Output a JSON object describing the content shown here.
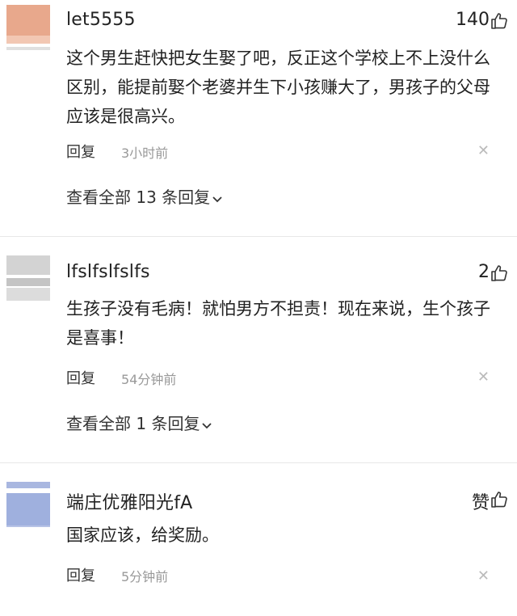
{
  "comments": [
    {
      "username": "let5555",
      "likes": "140",
      "body": "这个男生赶快把女生娶了吧，反正这个学校上不上没什么区别，能提前娶个老婆并生下小孩赚大了，男孩子的父母应该是很高兴。",
      "reply_label": "回复",
      "time": "3小时前",
      "view_all": "查看全部 13 条回复",
      "avatar_colors": [
        "#e8a88c",
        "#f2c7b3",
        "#e0e0e0"
      ]
    },
    {
      "username": "lfslfslfslfs",
      "likes": "2",
      "body": "生孩子没有毛病！就怕男方不担责！现在来说，生个孩子是喜事！",
      "reply_label": "回复",
      "time": "54分钟前",
      "view_all": "查看全部 1 条回复",
      "avatar_colors": [
        "#d3d3d3",
        "#c4c4c4",
        "#dcdcdc"
      ]
    },
    {
      "username": "端庄优雅阳光fA",
      "likes": "赞",
      "body": "国家应该，给奖励。",
      "reply_label": "回复",
      "time": "5分钟前",
      "avatar_colors": [
        "#a9b7e0",
        "#9fb0de",
        "#b6c2e6"
      ]
    }
  ]
}
